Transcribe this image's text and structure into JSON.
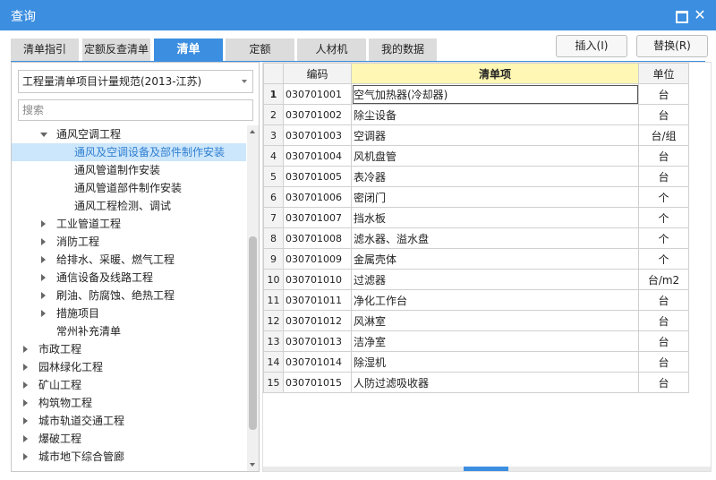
{
  "window": {
    "title": "查询"
  },
  "tabs": [
    {
      "label": "清单指引",
      "active": false
    },
    {
      "label": "定额反查清单",
      "active": false
    },
    {
      "label": "清单",
      "active": true
    },
    {
      "label": "定额",
      "active": false
    },
    {
      "label": "人材机",
      "active": false
    },
    {
      "label": "我的数据",
      "active": false
    }
  ],
  "buttons": {
    "insert": "插入(I)",
    "replace": "替换(R)"
  },
  "library": {
    "selected": "工程量清单项目计量规范(2013-江苏)"
  },
  "search": {
    "placeholder": "搜索",
    "value": ""
  },
  "tree": [
    {
      "label": "通风空调工程",
      "state": "expanded",
      "level": 2,
      "selected": false
    },
    {
      "label": "通风及空调设备及部件制作安装",
      "state": "leaf",
      "level": 3,
      "selected": true
    },
    {
      "label": "通风管道制作安装",
      "state": "leaf",
      "level": 3,
      "selected": false
    },
    {
      "label": "通风管道部件制作安装",
      "state": "leaf",
      "level": 3,
      "selected": false
    },
    {
      "label": "通风工程检测、调试",
      "state": "leaf",
      "level": 3,
      "selected": false
    },
    {
      "label": "工业管道工程",
      "state": "collapsed",
      "level": 2,
      "selected": false
    },
    {
      "label": "消防工程",
      "state": "collapsed",
      "level": 2,
      "selected": false
    },
    {
      "label": "给排水、采暖、燃气工程",
      "state": "collapsed",
      "level": 2,
      "selected": false
    },
    {
      "label": "通信设备及线路工程",
      "state": "collapsed",
      "level": 2,
      "selected": false
    },
    {
      "label": "刷油、防腐蚀、绝热工程",
      "state": "collapsed",
      "level": 2,
      "selected": false
    },
    {
      "label": "措施项目",
      "state": "collapsed",
      "level": 2,
      "selected": false
    },
    {
      "label": "常州补充清单",
      "state": "leaf",
      "level": 2,
      "selected": false
    },
    {
      "label": "市政工程",
      "state": "collapsed",
      "level": 1,
      "selected": false
    },
    {
      "label": "园林绿化工程",
      "state": "collapsed",
      "level": 1,
      "selected": false
    },
    {
      "label": "矿山工程",
      "state": "collapsed",
      "level": 1,
      "selected": false
    },
    {
      "label": "构筑物工程",
      "state": "collapsed",
      "level": 1,
      "selected": false
    },
    {
      "label": "城市轨道交通工程",
      "state": "collapsed",
      "level": 1,
      "selected": false
    },
    {
      "label": "爆破工程",
      "state": "collapsed",
      "level": 1,
      "selected": false
    },
    {
      "label": "城市地下综合管廊",
      "state": "collapsed",
      "level": 1,
      "selected": false
    }
  ],
  "grid": {
    "columns": {
      "code": "编码",
      "name": "清单项",
      "unit": "单位"
    },
    "rows": [
      {
        "num": "1",
        "code": "030701001",
        "name": "空气加热器(冷却器)",
        "unit": "台"
      },
      {
        "num": "2",
        "code": "030701002",
        "name": "除尘设备",
        "unit": "台"
      },
      {
        "num": "3",
        "code": "030701003",
        "name": "空调器",
        "unit": "台/组"
      },
      {
        "num": "4",
        "code": "030701004",
        "name": "风机盘管",
        "unit": "台"
      },
      {
        "num": "5",
        "code": "030701005",
        "name": "表冷器",
        "unit": "台"
      },
      {
        "num": "6",
        "code": "030701006",
        "name": "密闭门",
        "unit": "个"
      },
      {
        "num": "7",
        "code": "030701007",
        "name": "挡水板",
        "unit": "个"
      },
      {
        "num": "8",
        "code": "030701008",
        "name": "滤水器、溢水盘",
        "unit": "个"
      },
      {
        "num": "9",
        "code": "030701009",
        "name": "金属壳体",
        "unit": "个"
      },
      {
        "num": "10",
        "code": "030701010",
        "name": "过滤器",
        "unit": "台/m2"
      },
      {
        "num": "11",
        "code": "030701011",
        "name": "净化工作台",
        "unit": "台"
      },
      {
        "num": "12",
        "code": "030701012",
        "name": "风淋室",
        "unit": "台"
      },
      {
        "num": "13",
        "code": "030701013",
        "name": "洁净室",
        "unit": "台"
      },
      {
        "num": "14",
        "code": "030701014",
        "name": "除湿机",
        "unit": "台"
      },
      {
        "num": "15",
        "code": "030701015",
        "name": "人防过滤吸收器",
        "unit": "台"
      }
    ]
  },
  "colors": {
    "accent": "#3b8ee0",
    "selected_bg": "#cce6fb",
    "header_highlight": "#fff7b3"
  }
}
